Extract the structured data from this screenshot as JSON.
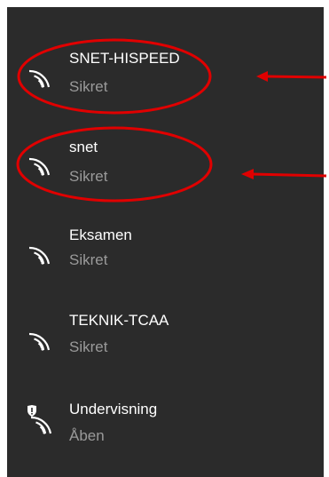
{
  "networks": [
    {
      "name": "SNET-HISPEED",
      "status": "Sikret",
      "icon": "wifi-icon"
    },
    {
      "name": "snet",
      "status": "Sikret",
      "icon": "wifi-icon"
    },
    {
      "name": "Eksamen",
      "status": "Sikret",
      "icon": "wifi-icon"
    },
    {
      "name": "TEKNIK-TCAA",
      "status": "Sikret",
      "icon": "wifi-icon"
    },
    {
      "name": "Undervisning",
      "status": "Åben",
      "icon": "wifi-open-shield-icon"
    }
  ],
  "annotations": {
    "highlight_color": "#e00000"
  },
  "colors": {
    "panel_background": "#2b2b2b",
    "name_text": "#ffffff",
    "status_text": "#9a9a9a"
  }
}
